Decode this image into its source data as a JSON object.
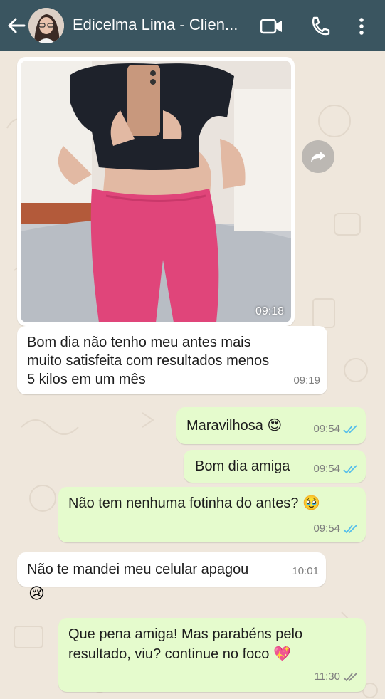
{
  "header": {
    "contact_name": "Edicelma Lima - Clien...",
    "colors": {
      "bar": "#3a5560",
      "icons": "#ffffff"
    }
  },
  "messages": [
    {
      "type": "image",
      "direction": "incoming",
      "time": "09:18"
    },
    {
      "type": "text",
      "direction": "incoming",
      "lines": [
        "Bom dia não tenho meu antes mais",
        "muito satisfeita com resultados menos",
        "5 kilos em um mês"
      ],
      "time": "09:19"
    },
    {
      "type": "text",
      "direction": "outgoing",
      "text": "Maravilhosa 😍",
      "time": "09:54",
      "status": "read"
    },
    {
      "type": "text",
      "direction": "outgoing",
      "text": "Bom dia amiga",
      "time": "09:54",
      "status": "read"
    },
    {
      "type": "text",
      "direction": "outgoing",
      "text": "Não tem nenhuma fotinha do antes? 🥹",
      "time": "09:54",
      "status": "read"
    },
    {
      "type": "text",
      "direction": "incoming",
      "text": "Não te mandei meu celular apagou",
      "time": "10:01"
    },
    {
      "type": "emoji",
      "direction": "incoming",
      "text": "😢"
    },
    {
      "type": "text",
      "direction": "outgoing",
      "lines": [
        "Que pena amiga! Mas parabéns pelo",
        "resultado, viu? continue no foco 💖"
      ],
      "time": "11:30",
      "status": "delivered"
    }
  ],
  "colors": {
    "chat_background": "#efe7dc",
    "incoming_bubble": "#ffffff",
    "outgoing_bubble": "#e5fbcd",
    "read_ticks": "#53bdeb",
    "delivered_ticks": "#8a8a8a"
  }
}
